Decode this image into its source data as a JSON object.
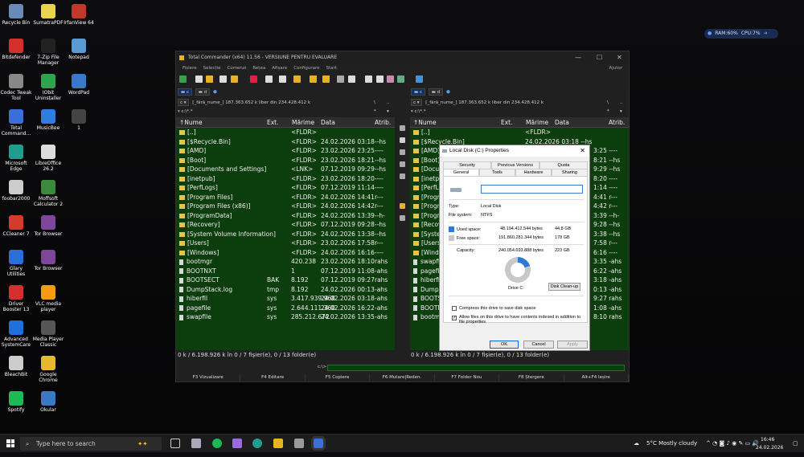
{
  "desktop": {
    "icons": [
      {
        "label": "Recycle Bin",
        "color": "#6a8ab8"
      },
      {
        "label": "SumatraPDF",
        "color": "#e8d44d"
      },
      {
        "label": "IrfanView 64",
        "color": "#c0392b"
      },
      {
        "label": "Bitdefender",
        "color": "#d62d2d"
      },
      {
        "label": "7-Zip File Manager",
        "color": "#222222"
      },
      {
        "label": "Notepad",
        "color": "#5b9bd5"
      },
      {
        "label": "Codec Tweak Tool",
        "color": "#888888"
      },
      {
        "label": "IObit Uninstaller",
        "color": "#2ea44f"
      },
      {
        "label": "WordPad",
        "color": "#3a78c9"
      },
      {
        "label": "Total Command...",
        "color": "#3a6ed8"
      },
      {
        "label": "MusicBee",
        "color": "#2f7de1"
      },
      {
        "label": "1",
        "color": "#444444"
      },
      {
        "label": "Microsoft Edge",
        "color": "#1f9d8f"
      },
      {
        "label": "LibreOffice 26.2",
        "color": "#dddddd"
      },
      {
        "label": "foobar2000",
        "color": "#cccccc"
      },
      {
        "label": "Moffsoft Calculator 2",
        "color": "#3b8a3b"
      },
      {
        "label": "CCleaner 7",
        "color": "#d63a2f"
      },
      {
        "label": "Tor Browser",
        "color": "#7d4698"
      },
      {
        "label": "Glary Utilities",
        "color": "#2a6fd6"
      },
      {
        "label": "Tor Browser",
        "color": "#7d4698"
      },
      {
        "label": "Driver Booster 13",
        "color": "#d32f2f"
      },
      {
        "label": "VLC media player",
        "color": "#f39c12"
      },
      {
        "label": "Advanced SystemCare",
        "color": "#1e6fd9"
      },
      {
        "label": "Media Player Classic",
        "color": "#555555"
      },
      {
        "label": "BleachBit",
        "color": "#cccccc"
      },
      {
        "label": "Google Chrome",
        "color": "#e5b82f"
      },
      {
        "label": "Spotify",
        "color": "#1db954"
      },
      {
        "label": "Okular",
        "color": "#3a79c2"
      }
    ],
    "widget": {
      "ram": "RAM:60%",
      "cpu": "CPU:7%"
    }
  },
  "tc": {
    "title": "Total Commander (x64) 11.56 - VERSIUNE PENTRU EVALUARE",
    "menu": [
      "Fișiere",
      "Selecție",
      "Comenzi",
      "Rețea",
      "Afișare",
      "Configurare",
      "Start"
    ],
    "help": "Ajutor",
    "left": {
      "drive_c": "c",
      "drive_d": "d",
      "drive_select": "c",
      "label": "[_fără_nume_]",
      "space": "187.363.652 k liber din 234.428.412 k",
      "path": "c:\\*.*",
      "cwd": "c:\\",
      "status": "0 k / 6.198.926 k în 0 / 7 fișier(e), 0 / 13 folder(e)"
    },
    "right": {
      "drive_c": "c",
      "drive_d": "d",
      "drive_select": "c",
      "label": "[_fără_nume_]",
      "space": "187.363.652 k liber din 234.428.412 k",
      "path": "c:\\*.*",
      "cwd": "c:\\",
      "status": "0 k / 6.198.926 k în 0 / 7 fișier(e), 0 / 13 folder(e)"
    },
    "columns": {
      "name": "Nume",
      "ext": "Ext.",
      "size": "Mărime",
      "date": "Data",
      "attr": "Atrib."
    },
    "files": [
      {
        "name": "[..]",
        "ext": "",
        "size": "<FLDR>",
        "date": "",
        "attr": "",
        "kind": "up"
      },
      {
        "name": "[$Recycle.Bin]",
        "ext": "",
        "size": "<FLDR>",
        "date": "24.02.2026 03:18",
        "attr": "--hs",
        "kind": "dir"
      },
      {
        "name": "[AMD]",
        "ext": "",
        "size": "<FLDR>",
        "date": "23.02.2026 23:25",
        "attr": "----",
        "kind": "dir"
      },
      {
        "name": "[Boot]",
        "ext": "",
        "size": "<FLDR>",
        "date": "23.02.2026 18:21",
        "attr": "--hs",
        "kind": "dir"
      },
      {
        "name": "[Documents and Settings]",
        "ext": "",
        "size": "<LNK>",
        "date": "07.12.2019 09:29",
        "attr": "--hs",
        "kind": "dir"
      },
      {
        "name": "[inetpub]",
        "ext": "",
        "size": "<FLDR>",
        "date": "23.02.2026 18:20",
        "attr": "----",
        "kind": "dir"
      },
      {
        "name": "[PerfLogs]",
        "ext": "",
        "size": "<FLDR>",
        "date": "07.12.2019 11:14",
        "attr": "----",
        "kind": "dir"
      },
      {
        "name": "[Program Files]",
        "ext": "",
        "size": "<FLDR>",
        "date": "24.02.2026 14:41",
        "attr": "r---",
        "kind": "dir"
      },
      {
        "name": "[Program Files (x86)]",
        "ext": "",
        "size": "<FLDR>",
        "date": "24.02.2026 14:42",
        "attr": "r---",
        "kind": "dir"
      },
      {
        "name": "[ProgramData]",
        "ext": "",
        "size": "<FLDR>",
        "date": "24.02.2026 13:39",
        "attr": "--h-",
        "kind": "dir"
      },
      {
        "name": "[Recovery]",
        "ext": "",
        "size": "<FLDR>",
        "date": "07.12.2019 09:28",
        "attr": "--hs",
        "kind": "dir"
      },
      {
        "name": "[System Volume Information]",
        "ext": "",
        "size": "<FLDR>",
        "date": "24.02.2026 13:38",
        "attr": "--hs",
        "kind": "dir"
      },
      {
        "name": "[Users]",
        "ext": "",
        "size": "<FLDR>",
        "date": "23.02.2026 17:58",
        "attr": "r---",
        "kind": "dir"
      },
      {
        "name": "[Windows]",
        "ext": "",
        "size": "<FLDR>",
        "date": "24.02.2026 16:16",
        "attr": "----",
        "kind": "dir"
      },
      {
        "name": "bootmgr",
        "ext": "",
        "size": "420.238",
        "date": "23.02.2026 18:10",
        "attr": "rahs",
        "kind": "file"
      },
      {
        "name": "BOOTNXT",
        "ext": "",
        "size": "1",
        "date": "07.12.2019 11:08",
        "attr": "-ahs",
        "kind": "file"
      },
      {
        "name": "BOOTSECT",
        "ext": "BAK",
        "size": "8.192",
        "date": "07.12.2019 09:27",
        "attr": "rahs",
        "kind": "file"
      },
      {
        "name": "DumpStack.log",
        "ext": "tmp",
        "size": "8.192",
        "date": "24.02.2026 00:13",
        "attr": "-ahs",
        "kind": "file"
      },
      {
        "name": "hiberfil",
        "ext": "sys",
        "size": "3.417.939.968",
        "date": "24.02.2026 03:18",
        "attr": "-ahs",
        "kind": "file"
      },
      {
        "name": "pagefile",
        "ext": "sys",
        "size": "2.644.111.360",
        "date": "24.02.2026 16:22",
        "attr": "-ahs",
        "kind": "file"
      },
      {
        "name": "swapfile",
        "ext": "sys",
        "size": "285.212.672",
        "date": "24.02.2026 13:35",
        "attr": "-ahs",
        "kind": "file"
      }
    ],
    "right_visible_names": [
      "[..]",
      "[$Recycle.Bin]",
      "[AMD]",
      "[Boot]",
      "[Docum",
      "[inetpu",
      "[PerfLo",
      "[Progra",
      "[Progra",
      "[Progra",
      "[Recove",
      "[Syster",
      "[Users]",
      "[Windo",
      "swapfil",
      "pagefil",
      "hiberfil",
      "DumpS",
      "BOOTS",
      "BOOTN",
      "bootmg"
    ],
    "right_visible_tail": [
      "<FLDR>",
      "24.02.2026 03:18  --hs",
      "3:25  ----",
      "8:21  --hs",
      "9:29  --hs",
      "8:20  ----",
      "1:14  ----",
      "4:41  r---",
      "4:42  r---",
      "3:39  --h-",
      "9:28  --hs",
      "3:38  --hs",
      "7:58  r---",
      "6:16  ----",
      "3:35  -ahs",
      "6:22  -ahs",
      "3:18  -ahs",
      "0:13  -ahs",
      "9:27  rahs",
      "1:08  -ahs",
      "8:10  rahs"
    ],
    "cmd_prefix": "c:\\>",
    "fkeys": [
      "F3 Vizualizare",
      "F4 Editare",
      "F5 Copiere",
      "F6 Mutare|Reden.",
      "F7 Folder Nou",
      "F8 Ștergere",
      "Alt+F4 Ieșire"
    ]
  },
  "dialog": {
    "title": "Local Disk (C:) Properties",
    "tabs_row1": [
      "Security",
      "Previous Versions",
      "Quota"
    ],
    "tabs_row2": [
      "General",
      "Tools",
      "Hardware",
      "Sharing"
    ],
    "type_label": "Type:",
    "type_value": "Local Disk",
    "fs_label": "File system:",
    "fs_value": "NTFS",
    "used_label": "Used space:",
    "used_bytes": "48.194.412.544 bytes",
    "used_gb": "44,8 GB",
    "free_label": "Free space:",
    "free_bytes": "191.860.281.344 bytes",
    "free_gb": "178 GB",
    "cap_label": "Capacity:",
    "cap_bytes": "240.054.693.888 bytes",
    "cap_gb": "223 GB",
    "drive_label": "Drive C:",
    "cleanup": "Disk Clean-up",
    "compress": "Compress this drive to save disk space",
    "index": "Allow files on this drive to have contents indexed in addition to file properties",
    "ok": "OK",
    "cancel": "Cancel",
    "apply": "Apply",
    "used_fraction": 0.2,
    "colors": {
      "used": "#2c7ad6",
      "free": "#c8c8c8"
    }
  },
  "taskbar": {
    "search_placeholder": "Type here to search",
    "weather": "5°C  Mostly cloudy",
    "time": "16:46",
    "date": "24.02.2026"
  }
}
